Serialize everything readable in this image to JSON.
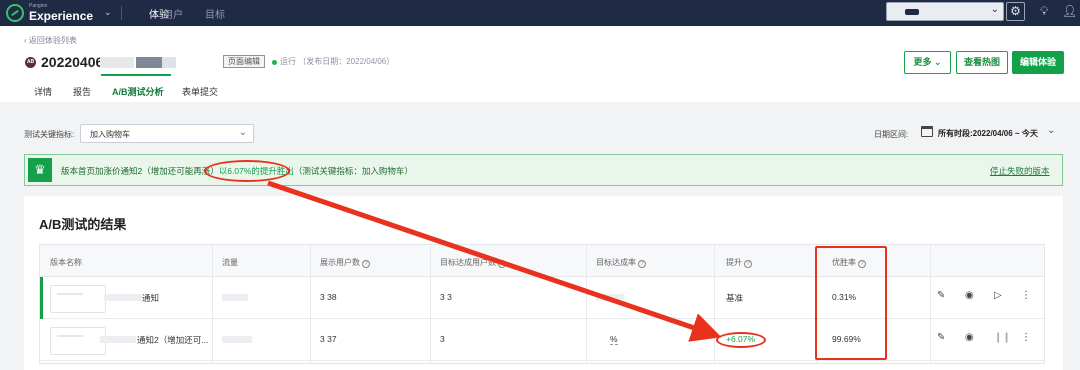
{
  "topbar": {
    "brand_small": "Pangine",
    "brand": "Experience",
    "nav": [
      "体验",
      "用户",
      "目标"
    ],
    "active_nav": "体验"
  },
  "header": {
    "back_link": "返回体验列表",
    "badge": "AB",
    "title": "20220406",
    "tag": "页面编辑",
    "status": "运行 （发布日期：2022/04/06）",
    "buttons": {
      "more": "更多",
      "heatmap": "查看热图",
      "edit": "编辑体验"
    },
    "tabs": [
      "详情",
      "报告",
      "A/B测试分析",
      "表单提交"
    ],
    "active_tab": "A/B测试分析"
  },
  "filter": {
    "metric_label": "测试关键指标:",
    "metric_value": "加入购物车",
    "date_label": "日期区间:",
    "date_value": "所有时段:2022/04/06 ~ 今天"
  },
  "banner": {
    "text_prefix": "版本首页加涨价通知2（增加还可能再涨）",
    "text_lift": "以6.07%的提升胜出",
    "text_suffix": "（测试关键指标：加入购物车）",
    "link": "停止失败的版本"
  },
  "results": {
    "title": "A/B测试的结果",
    "columns": [
      "版本名称",
      "流量",
      "展示用户数",
      "目标达成用户数",
      "目标达成率",
      "提升",
      "优胜率"
    ],
    "rows": [
      {
        "name": "通知",
        "users": "3 38",
        "conversions": "3 3",
        "lift": "基准",
        "win_rate": "0.31%"
      },
      {
        "name": "通知2（增加还可...",
        "users": "3 37",
        "conversions": "3",
        "rate": "%",
        "lift": "+6.07%",
        "win_rate": "99.69%"
      }
    ]
  },
  "colors": {
    "accent": "#13a04a",
    "topbar": "#1f2a44",
    "annotation": "#e8321e"
  }
}
